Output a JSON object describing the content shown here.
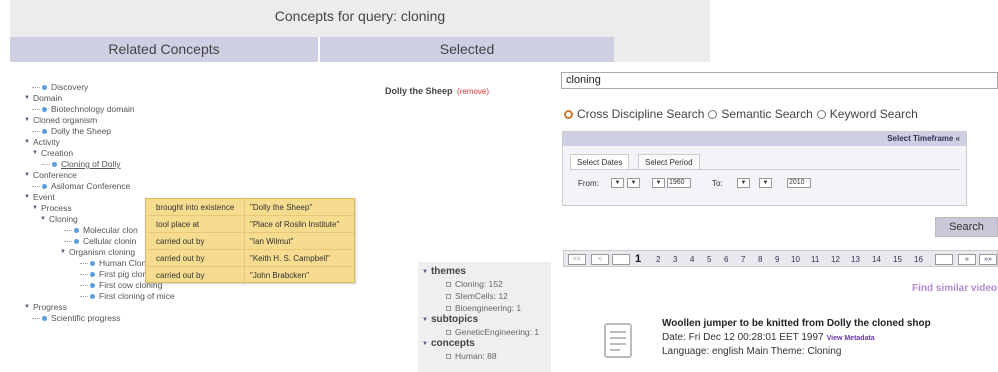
{
  "header": {
    "title": "Concepts for query: cloning",
    "related_label": "Related Concepts",
    "selected_label": "Selected"
  },
  "tree": [
    {
      "label": "Discovery",
      "level": 1,
      "kind": "leaf"
    },
    {
      "label": "Domain",
      "level": 0,
      "kind": "group"
    },
    {
      "label": "Biotechnology domain",
      "level": 1,
      "kind": "leaf"
    },
    {
      "label": "Cloned organism",
      "level": 0,
      "kind": "group"
    },
    {
      "label": "Dolly the Sheep",
      "level": 1,
      "kind": "leaf"
    },
    {
      "label": "Activity",
      "level": 0,
      "kind": "group"
    },
    {
      "label": "Creation",
      "level": 1,
      "kind": "group"
    },
    {
      "label": "Cloning of Dolly",
      "level": 2,
      "kind": "link"
    },
    {
      "label": "Conference",
      "level": 0,
      "kind": "group"
    },
    {
      "label": "Asilomar Conference",
      "level": 1,
      "kind": "leaf"
    },
    {
      "label": "Event",
      "level": 0,
      "kind": "group"
    },
    {
      "label": "Process",
      "level": 1,
      "kind": "group"
    },
    {
      "label": "Cloning",
      "level": 2,
      "kind": "group"
    },
    {
      "label": "Molecular clon",
      "level": 3,
      "kind": "leaf"
    },
    {
      "label": "Cellular clonin",
      "level": 3,
      "kind": "leaf"
    },
    {
      "label": "Organism cloning",
      "level": 2,
      "kind": "group"
    },
    {
      "label": "Human Cloning",
      "level": 3,
      "kind": "leaf"
    },
    {
      "label": "First pig cloning",
      "level": 3,
      "kind": "leaf"
    },
    {
      "label": "First cow cloning",
      "level": 3,
      "kind": "leaf"
    },
    {
      "label": "First cloning of mice",
      "level": 3,
      "kind": "leaf"
    },
    {
      "label": "Progress",
      "level": 0,
      "kind": "group"
    },
    {
      "label": "Scientific progress",
      "level": 1,
      "kind": "leaf"
    }
  ],
  "popup": [
    {
      "predicate": "brought into existence",
      "object": "\"Dolly the Sheep\""
    },
    {
      "predicate": "tool place at",
      "object": "\"Place of Roslin Institute\""
    },
    {
      "predicate": "carried out by",
      "object": "\"Ian Wilmut\""
    },
    {
      "predicate": "carried out by",
      "object": "\"Keith H. S. Campbell\""
    },
    {
      "predicate": "carried out by",
      "object": "\"John Brabcken\""
    }
  ],
  "selected": {
    "item": "Dolly the Sheep",
    "remove_label": "(remove)"
  },
  "facets": {
    "themes_label": "themes",
    "themes": [
      "Cloning: 152",
      "StemCells: 12",
      "Bioengineering: 1"
    ],
    "subtopics_label": "subtopics",
    "subtopics": [
      "GeneticEngineering: 1"
    ],
    "concepts_label": "concepts",
    "concepts": [
      "Human: 88"
    ]
  },
  "search": {
    "value": "cloning",
    "options": [
      "Cross Discipline Search",
      "Semantic Search",
      "Keyword Search"
    ],
    "selected_option": "Cross Discipline Search",
    "button_label": "Search"
  },
  "timeframe": {
    "header": "Select Timeframe «",
    "tab_dates": "Select Dates",
    "tab_period": "Select Period",
    "from_label": "From:",
    "from_year": "1960",
    "to_label": "To:",
    "to_year": "2010",
    "dropdown_arrow": "▼"
  },
  "pager": {
    "first": "<<",
    "prev": "<",
    "pages": [
      "1",
      "2",
      "3",
      "4",
      "5",
      "6",
      "7",
      "8",
      "9",
      "10",
      "11",
      "12",
      "13",
      "14",
      "15",
      "16"
    ],
    "current": "1",
    "next": "»",
    "last": "»»"
  },
  "find_similar": "Find similar videos",
  "result": {
    "title": "Woollen jumper to be knitted from Dolly the cloned shop",
    "date": "Date: Fri Dec 12 00:28:01 EET 1997",
    "meta_link": "View Metadata",
    "language": "Language: english Main Theme: Cloning"
  }
}
